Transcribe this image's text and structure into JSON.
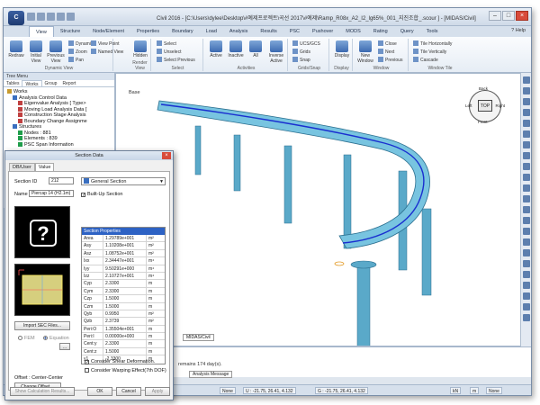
{
  "app": {
    "title": "Civil 2016 - [C:\\Users\\dylee\\Desktop\\#예제프로젝트\\곡선 2017\\#예제\\Ramp_R08x_A2_I2_lg65%_001_지진조합_.scour ] - [MIDAS/Civil]",
    "logo": "C"
  },
  "menu_tabs": [
    "View",
    "Structure",
    "Node/Element",
    "Properties",
    "Boundary",
    "Load",
    "Analysis",
    "Results",
    "PSC",
    "Pushover",
    "MODS",
    "Rating",
    "Query",
    "Tools"
  ],
  "active_tab": "View",
  "help_label": "Help",
  "ribbon": {
    "groups": [
      {
        "label": "Dynamic View",
        "big": [
          "Redraw",
          "Initial View",
          "Previous View"
        ],
        "small": [
          "Dynamic",
          "Zoom",
          "Pan",
          "View Point",
          "Named View"
        ]
      },
      {
        "label": "Render View",
        "big": [
          "Hidden"
        ],
        "small": []
      },
      {
        "label": "Select",
        "big": [],
        "small": [
          "Select",
          "Unselect",
          "Select Previous"
        ]
      },
      {
        "label": "Activities",
        "big": [
          "Active",
          "Inactive",
          "All",
          "Inverse Active"
        ],
        "small": []
      },
      {
        "label": "Grids/Snap",
        "big": [],
        "small": [
          "UCS/GCS",
          "Grids",
          "Snap"
        ]
      },
      {
        "label": "Display",
        "big": [
          "Display"
        ],
        "small": []
      },
      {
        "label": "Window",
        "big": [
          "New Window"
        ],
        "small": [
          "Close",
          "Next",
          "Previous"
        ]
      },
      {
        "label": "Window Tile",
        "big": [],
        "small": [
          "Tile Horizontally",
          "Tile Vertically",
          "Cascade"
        ]
      }
    ]
  },
  "tree_panel": {
    "header": "Tree Menu",
    "tabs": [
      "Tables",
      "Works",
      "Group",
      "Report"
    ],
    "active_tab": "Works",
    "items": [
      {
        "text": "Works",
        "level": 0
      },
      {
        "text": "Analysis Control Data",
        "level": 1
      },
      {
        "text": "Eigenvalue Analysis [ Type>",
        "level": 2
      },
      {
        "text": "Moving Load Analysis Data [",
        "level": 2
      },
      {
        "text": "Construction Stage Analysis",
        "level": 2
      },
      {
        "text": "Boundary Change Assignme",
        "level": 2
      },
      {
        "text": "Structures",
        "level": 1
      },
      {
        "text": "Nodes : 881",
        "level": 2
      },
      {
        "text": "Elements : 839",
        "level": 2
      },
      {
        "text": "PSC Span Information",
        "level": 2
      }
    ]
  },
  "viewport": {
    "label": "Base",
    "doc_tab": "MIDAS/Civil",
    "viewcube": {
      "top": "TOP",
      "back": "Back",
      "front": "Front",
      "left": "Left",
      "right": "Right"
    }
  },
  "message": {
    "text": "remains 174 day(s).",
    "tab": "Analysis Message"
  },
  "status": {
    "none": "None",
    "u_coord": "U : -21.75, 26.41, 4.132",
    "g_coord": "G : -21.75, 26.41, 4.132",
    "unit_force": "kN",
    "unit_length": "m",
    "extra": "None"
  },
  "dialog": {
    "title": "Section Data",
    "tabs": [
      "DB/User",
      "Value"
    ],
    "active_tab": "Value",
    "section_id_label": "Section ID",
    "section_id": "212",
    "section_type": "General Section",
    "name_label": "Name",
    "name": "Piercap 14 (H2.1m)",
    "built_up_label": "Built-Up Section",
    "built_up_checked": true,
    "question_mark": "?",
    "props_header": "Section Properties",
    "properties": [
      {
        "name": "Area",
        "value": "1.29789e+001",
        "unit": "m²"
      },
      {
        "name": "Asy",
        "value": "1.10208e+001",
        "unit": "m²"
      },
      {
        "name": "Asz",
        "value": "1.08752e+001",
        "unit": "m²"
      },
      {
        "name": "Ixx",
        "value": "2.34447e+001",
        "unit": "m⁴"
      },
      {
        "name": "Iyy",
        "value": "9.50291e+000",
        "unit": "m⁴"
      },
      {
        "name": "Izz",
        "value": "2.10727e+001",
        "unit": "m⁴"
      },
      {
        "name": "Cyp",
        "value": "2.3300",
        "unit": "m"
      },
      {
        "name": "Cym",
        "value": "2.3300",
        "unit": "m"
      },
      {
        "name": "Czp",
        "value": "1.5000",
        "unit": "m"
      },
      {
        "name": "Czm",
        "value": "1.5000",
        "unit": "m"
      },
      {
        "name": "Qyb",
        "value": "0.9950",
        "unit": "m²"
      },
      {
        "name": "Qzb",
        "value": "2.3739",
        "unit": "m²"
      },
      {
        "name": "Peri:O",
        "value": "1.35504e+001",
        "unit": "m"
      },
      {
        "name": "Peri:I",
        "value": "0.00000e+000",
        "unit": "m"
      },
      {
        "name": "Cent:y",
        "value": "2.3300",
        "unit": "m"
      },
      {
        "name": "Cent:z",
        "value": "1.5000",
        "unit": "m"
      },
      {
        "name": "y1",
        "value": "-2.3300",
        "unit": "m"
      }
    ],
    "import_btn": "Import SEC Files...",
    "fem_label": "FEM",
    "equation_label": "Equation",
    "shear_label": "Consider Shear Deformation.",
    "warping_label": "Consider Warping Effect(7th DOF)",
    "offset_label": "Offset : Center-Center",
    "change_offset": "Change Offset ...",
    "show_calc": "Show Calculation Results...",
    "ok": "OK",
    "cancel": "Cancel",
    "apply": "Apply",
    "colors": {
      "header": "#2d62c4",
      "section_fill": "#d6cf7e"
    }
  }
}
